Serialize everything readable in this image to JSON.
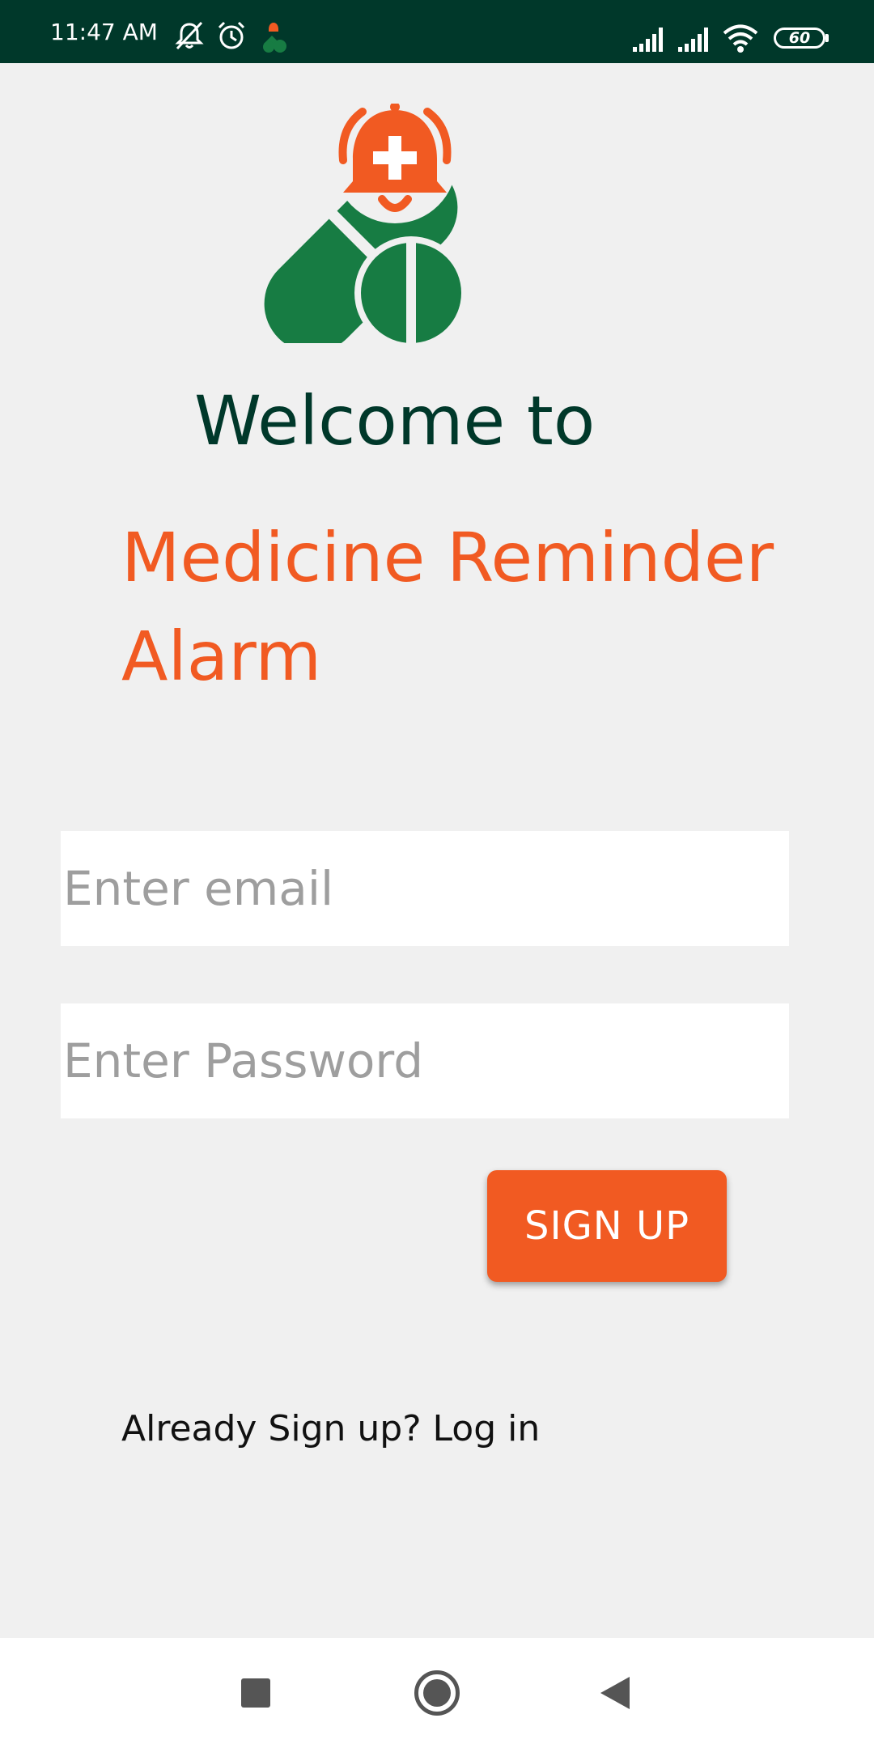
{
  "status_bar": {
    "time": "11:47 AM",
    "icons": [
      "notifications-off-icon",
      "alarm-icon",
      "app-notification-icon",
      "signal-icon",
      "signal-icon",
      "wifi-icon"
    ],
    "battery": "60"
  },
  "welcome_text": "Welcome to",
  "app_name": "Medicine Reminder Alarm",
  "form": {
    "email_placeholder": "Enter email",
    "password_placeholder": "Enter Password",
    "signup_label": "SIGN UP"
  },
  "login_prompt": "Already Sign up? Log in",
  "colors": {
    "status_bar": "#00382a",
    "background": "#f0f0f0",
    "accent_orange": "#f15a22",
    "logo_green": "#177c43",
    "heading_dark": "#00382a"
  },
  "nav_bar": {
    "icons": [
      "recents-icon",
      "home-icon",
      "back-icon"
    ]
  }
}
